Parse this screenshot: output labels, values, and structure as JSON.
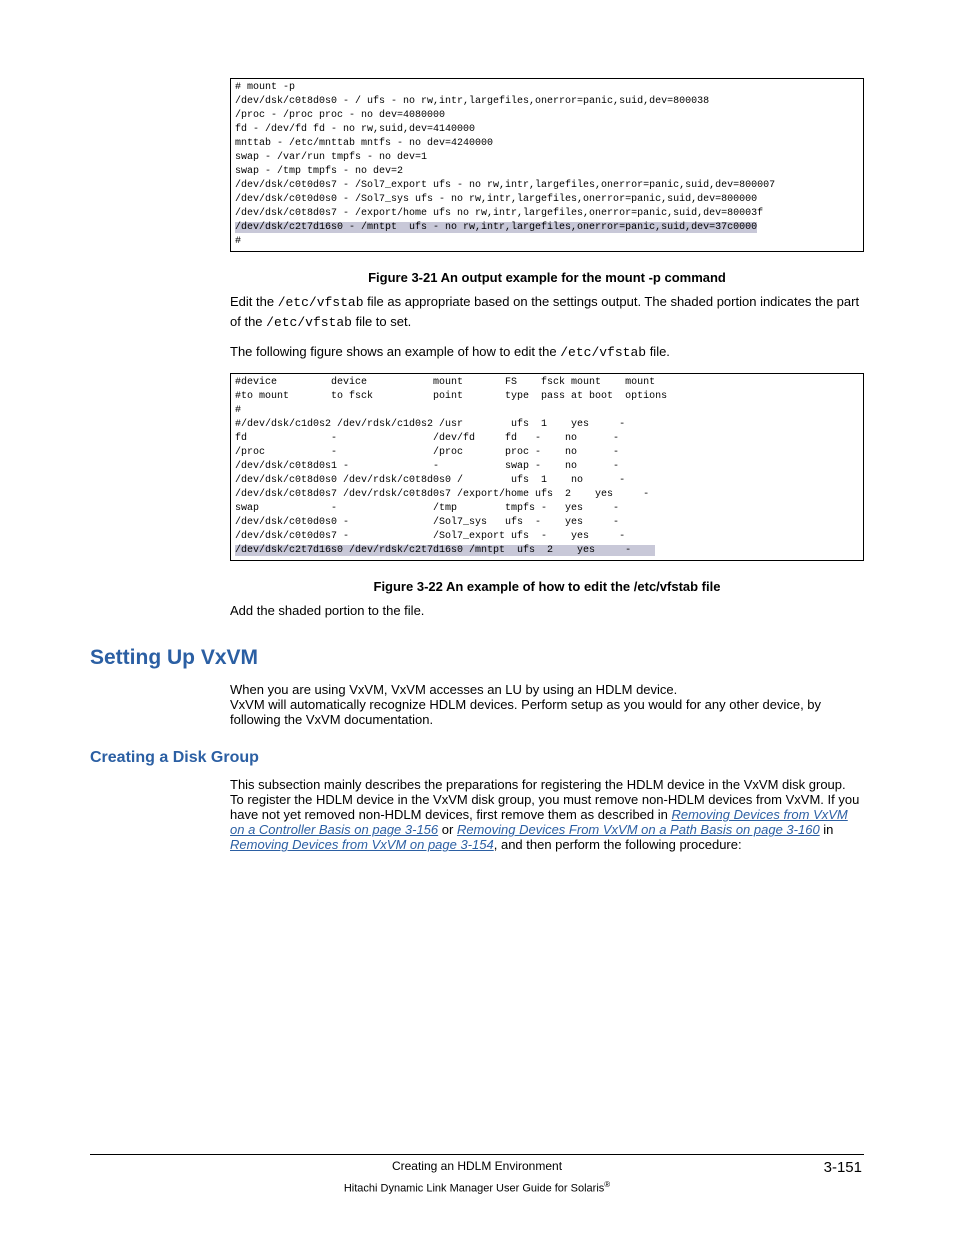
{
  "code_box_1": "# mount -p\n/dev/dsk/c0t8d0s0 - / ufs - no rw,intr,largefiles,onerror=panic,suid,dev=800038\n/proc - /proc proc - no dev=4080000\nfd - /dev/fd fd - no rw,suid,dev=4140000\nmnttab - /etc/mnttab mntfs - no dev=4240000\nswap - /var/run tmpfs - no dev=1\nswap - /tmp tmpfs - no dev=2\n/dev/dsk/c0t0d0s7 - /Sol7_export ufs - no rw,intr,largefiles,onerror=panic,suid,dev=800007\n/dev/dsk/c0t0d0s0 - /Sol7_sys ufs - no rw,intr,largefiles,onerror=panic,suid,dev=800000\n/dev/dsk/c0t8d0s7 - /export/home ufs no rw,intr,largefiles,onerror=panic,suid,dev=80003f",
  "code_box_1_shaded": "/dev/dsk/c2t7d16s0 - /mntpt  ufs - no rw,intr,largefiles,onerror=panic,suid,dev=37c0000",
  "code_box_1_after": "#",
  "fig_3_21": "Figure 3-21 An output example for the mount -p command",
  "para_edit_1a": "Edit the ",
  "para_edit_1_code": "/etc/vfstab",
  "para_edit_1b": " file as appropriate based on the settings output. The shaded portion indicates the part of the ",
  "para_edit_1_code2": "/etc/vfstab",
  "para_edit_1c": " file to set.",
  "para_edit_2a": "The following figure shows an example of how to edit the ",
  "para_edit_2_code": "/etc/vfstab",
  "para_edit_2b": " file.",
  "code_box_2": "#device         device           mount       FS    fsck mount    mount\n#to mount       to fsck          point       type  pass at boot  options\n#\n#/dev/dsk/c1d0s2 /dev/rdsk/c1d0s2 /usr        ufs  1    yes     -\nfd              -                /dev/fd     fd   -    no      -\n/proc           -                /proc       proc -    no      -\n/dev/dsk/c0t8d0s1 -              -           swap -    no      -\n/dev/dsk/c0t8d0s0 /dev/rdsk/c0t8d0s0 /        ufs  1    no      -\n/dev/dsk/c0t8d0s7 /dev/rdsk/c0t8d0s7 /export/home ufs  2    yes     -\nswap            -                /tmp        tmpfs -   yes     -\n/dev/dsk/c0t0d0s0 -              /Sol7_sys   ufs  -    yes     -\n/dev/dsk/c0t0d0s7 -              /Sol7_export ufs  -    yes     -",
  "code_box_2_shaded": "/dev/dsk/c2t7d16s0 /dev/rdsk/c2t7d16s0 /mntpt  ufs  2    yes     -    ",
  "fig_3_22": "Figure 3-22 An example of how to edit the /etc/vfstab file",
  "para_add": "Add the shaded portion to the file.",
  "h2_setting": "Setting Up VxVM",
  "para_vxvm_1": "When you are using VxVM, VxVM accesses an LU by using an HDLM device.",
  "para_vxvm_2": "VxVM will automatically recognize HDLM devices. Perform setup as you would for any other device, by following the VxVM documentation.",
  "h3_creating": "Creating a Disk Group",
  "para_dg_1": "This subsection mainly describes the preparations for registering the HDLM device in the VxVM disk group.",
  "para_dg_2a": "To register the HDLM device in the VxVM disk group, you must remove non-HDLM devices from VxVM. If you have not yet removed non-HDLM devices, first remove them as described in ",
  "link_1": "Removing Devices from VxVM on a Controller Basis on page 3-156",
  "para_dg_2b": " or ",
  "link_2": "Removing Devices From VxVM on a Path Basis on page 3-160",
  "para_dg_2c": " in ",
  "link_3": "Removing Devices from VxVM on page 3-154",
  "para_dg_2d": ", and then perform the following procedure:",
  "footer_chapter": "Creating an HDLM Environment",
  "footer_page": "3-151",
  "footer_book": "Hitachi Dynamic Link Manager User Guide for Solaris",
  "footer_reg": "®"
}
